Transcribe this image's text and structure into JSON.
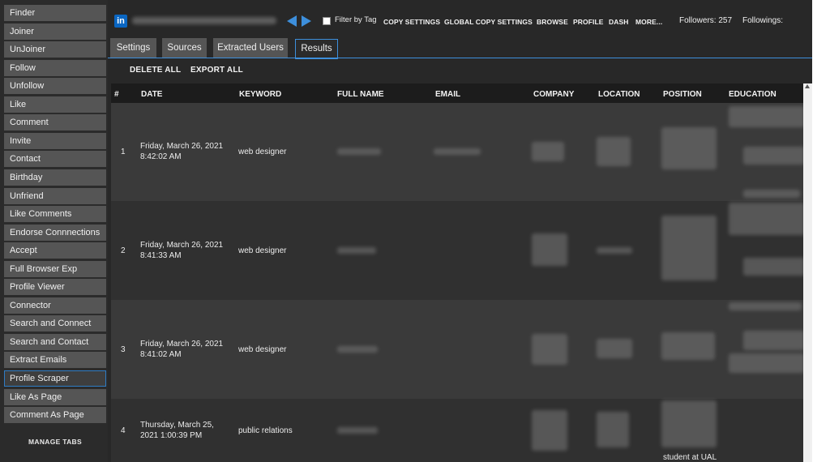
{
  "sidebar": {
    "items": [
      "Finder",
      "Joiner",
      "UnJoiner",
      "Follow",
      "Unfollow",
      "Like",
      "Comment",
      "Invite",
      "Contact",
      "Birthday",
      "Unfriend",
      "Like Comments",
      "Endorse Connnections",
      "Accept",
      "Full Browser Exp",
      "Profile Viewer",
      "Connector",
      "Search and Connect",
      "Search and Contact",
      "Extract Emails",
      "Profile Scraper",
      "Like As Page",
      "Comment As Page"
    ],
    "active_index": 20,
    "manage_tabs": "MANAGE TABS"
  },
  "header": {
    "logo": "in",
    "filter_label": "Filter by Tag",
    "links": [
      "COPY SETTINGS",
      "GLOBAL COPY SETTINGS",
      "BROWSE",
      "PROFILE",
      "DASH",
      "MORE..."
    ],
    "followers": "Followers: 257",
    "followings": "Followings:"
  },
  "tabs": [
    "Settings",
    "Sources",
    "Extracted Users",
    "Results"
  ],
  "active_tab": "Results",
  "actions": {
    "delete_all": "DELETE ALL",
    "export_all": "EXPORT ALL"
  },
  "table": {
    "columns": [
      "#",
      "DATE",
      "KEYWORD",
      "FULL NAME",
      "EMAIL",
      "COMPANY",
      "LOCATION",
      "POSITION",
      "EDUCATION"
    ],
    "rows": [
      {
        "num": "1",
        "date_line1": "Friday, March 26, 2021",
        "date_line2": "8:42:02 AM",
        "keyword": "web designer"
      },
      {
        "num": "2",
        "date_line1": "Friday, March 26, 2021",
        "date_line2": "8:41:33 AM",
        "keyword": "web designer"
      },
      {
        "num": "3",
        "date_line1": "Friday, March 26, 2021",
        "date_line2": "8:41:02 AM",
        "keyword": "web designer"
      },
      {
        "num": "4",
        "date_line1": "Thursday, March 25,",
        "date_line2": "2021 1:00:39 PM",
        "keyword": "public relations",
        "position_visible": "student at UAL"
      }
    ]
  },
  "colors": {
    "accent": "#3d8fdc",
    "linkedin": "#0a66c2",
    "sidebar_item": "#555555",
    "background": "#282828"
  }
}
